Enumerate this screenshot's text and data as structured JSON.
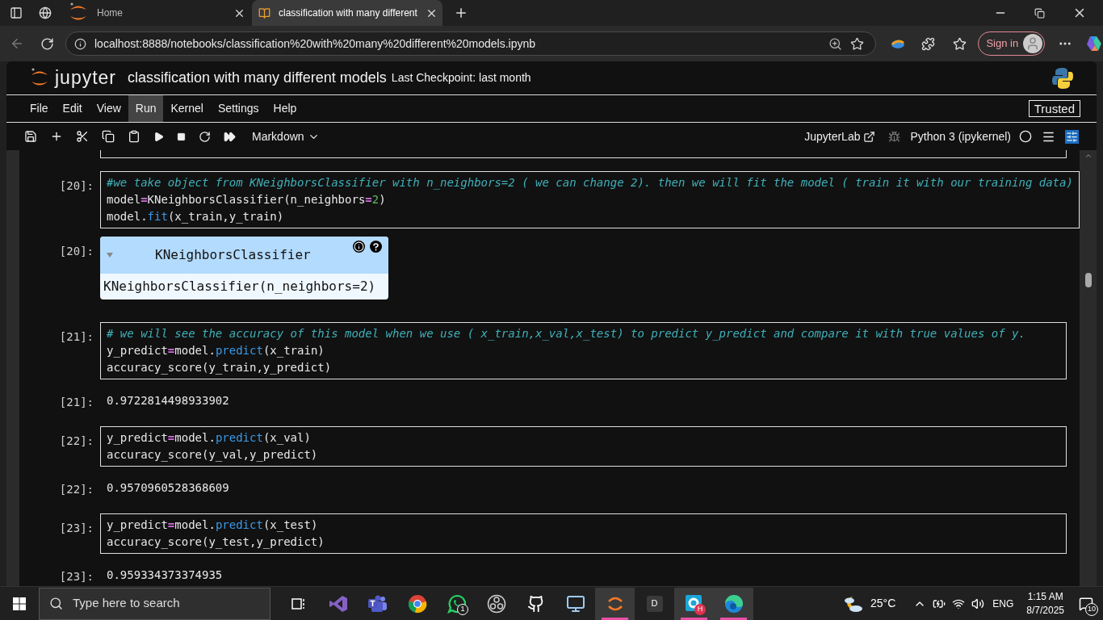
{
  "browser": {
    "tabs": [
      {
        "title": "Home",
        "selected": false,
        "kind": "jupyter"
      },
      {
        "title": "classification with many different",
        "selected": true,
        "kind": "notebook"
      }
    ],
    "url": "localhost:8888/notebooks/classification%20with%20many%20different%20models.ipynb",
    "sign_in": "Sign in"
  },
  "jupyter": {
    "logo": "jupyter",
    "title": "classification with many different models",
    "checkpoint": "Last Checkpoint: last month",
    "menu": [
      {
        "label": "File",
        "selected": false
      },
      {
        "label": "Edit",
        "selected": false
      },
      {
        "label": "View",
        "selected": false
      },
      {
        "label": "Run",
        "selected": true
      },
      {
        "label": "Kernel",
        "selected": false
      },
      {
        "label": "Settings",
        "selected": false
      },
      {
        "label": "Help",
        "selected": false
      }
    ],
    "trusted": "Trusted",
    "cell_type": "Markdown",
    "jupyterlab": "JupyterLab",
    "kernel": "Python 3 (ipykernel)"
  },
  "cells": [
    {
      "kind": "code",
      "prompt": "[20]:",
      "lines": [
        [
          {
            "t": "#we take object from KNeighborsClassifier with n_neighbors=2 ( we can change 2). then we will fit the model ( train it with our training data)",
            "kind": "comment"
          }
        ],
        [
          {
            "t": "model",
            "kind": "name"
          },
          {
            "t": "=",
            "kind": "op"
          },
          {
            "t": "KNeighborsClassifier(n_neighbors",
            "kind": "name"
          },
          {
            "t": "=",
            "kind": "op"
          },
          {
            "t": "2",
            "kind": "number"
          },
          {
            "t": ")",
            "kind": "name"
          }
        ],
        [
          {
            "t": "model.",
            "kind": "name"
          },
          {
            "t": "fit",
            "kind": "func"
          },
          {
            "t": "(x_train,y_train)",
            "kind": "name"
          }
        ]
      ]
    },
    {
      "kind": "widget",
      "prompt": "[20]:",
      "title": "KNeighborsClassifier",
      "repr": "KNeighborsClassifier(n_neighbors=2)"
    },
    {
      "kind": "code",
      "prompt": "[21]:",
      "lines": [
        [
          {
            "t": "# we will see the accuracy of this model when we use ( x_train,x_val,x_test) to predict y_predict and compare it with true values of y.",
            "kind": "comment"
          }
        ],
        [
          {
            "t": "y_predict",
            "kind": "name"
          },
          {
            "t": "=",
            "kind": "op"
          },
          {
            "t": "model.",
            "kind": "name"
          },
          {
            "t": "predict",
            "kind": "func"
          },
          {
            "t": "(x_train)",
            "kind": "name"
          }
        ],
        [
          {
            "t": "accuracy_score(y_train,y_predict)",
            "kind": "name"
          }
        ]
      ]
    },
    {
      "kind": "output",
      "prompt": "[21]:",
      "text": "0.9722814498933902"
    },
    {
      "kind": "code",
      "prompt": "[22]:",
      "lines": [
        [
          {
            "t": "y_predict",
            "kind": "name"
          },
          {
            "t": "=",
            "kind": "op"
          },
          {
            "t": "model.",
            "kind": "name"
          },
          {
            "t": "predict",
            "kind": "func"
          },
          {
            "t": "(x_val)",
            "kind": "name"
          }
        ],
        [
          {
            "t": "accuracy_score(y_val,y_predict)",
            "kind": "name"
          }
        ]
      ]
    },
    {
      "kind": "output",
      "prompt": "[22]:",
      "text": "0.9570960528368609"
    },
    {
      "kind": "code",
      "prompt": "[23]:",
      "lines": [
        [
          {
            "t": "y_predict",
            "kind": "name"
          },
          {
            "t": "=",
            "kind": "op"
          },
          {
            "t": "model.",
            "kind": "name"
          },
          {
            "t": "predict",
            "kind": "func"
          },
          {
            "t": "(x_test)",
            "kind": "name"
          }
        ],
        [
          {
            "t": "accuracy_score(y_test,y_predict)",
            "kind": "name"
          }
        ]
      ]
    },
    {
      "kind": "output",
      "prompt": "[23]:",
      "text": "0.959334373374935"
    }
  ],
  "taskbar": {
    "search_placeholder": "Type here to search",
    "apps": [
      {
        "kind": "taskview",
        "active": false
      },
      {
        "kind": "vs",
        "active": false
      },
      {
        "kind": "teams",
        "active": false
      },
      {
        "kind": "chrome",
        "active": false
      },
      {
        "kind": "whatsapp",
        "active": false,
        "badge": "1"
      },
      {
        "kind": "obs",
        "active": false
      },
      {
        "kind": "github",
        "active": false
      },
      {
        "kind": "monitor",
        "active": false
      },
      {
        "kind": "orange",
        "active": true
      },
      {
        "kind": "d",
        "active": false,
        "label": "D"
      },
      {
        "kind": "cyan",
        "active": true,
        "badge": "H"
      },
      {
        "kind": "edge",
        "active": true
      }
    ],
    "temperature": "25°C",
    "language": "ENG",
    "time": "1:15 AM",
    "date": "8/7/2025",
    "notifications": "10"
  }
}
